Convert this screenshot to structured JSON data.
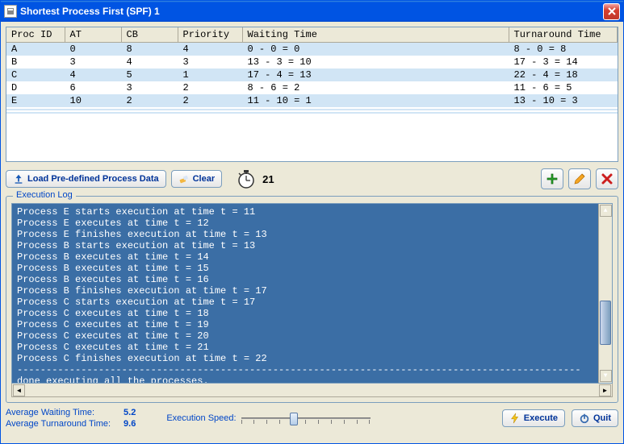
{
  "window": {
    "title": "Shortest Process First (SPF) 1"
  },
  "table": {
    "headers": [
      "Proc ID",
      "AT",
      "CB",
      "Priority",
      "Waiting Time",
      "Turnaround Time"
    ],
    "rows": [
      {
        "pid": "A",
        "at": "0",
        "cb": "8",
        "pr": "4",
        "wt": "0 - 0 = 0",
        "tt": "8 - 0 = 8"
      },
      {
        "pid": "B",
        "at": "3",
        "cb": "4",
        "pr": "3",
        "wt": "13 - 3 = 10",
        "tt": "17 - 3 = 14"
      },
      {
        "pid": "C",
        "at": "4",
        "cb": "5",
        "pr": "1",
        "wt": "17 - 4 = 13",
        "tt": "22 - 4 = 18"
      },
      {
        "pid": "D",
        "at": "6",
        "cb": "3",
        "pr": "2",
        "wt": "8 - 6 = 2",
        "tt": "11 - 6 = 5"
      },
      {
        "pid": "E",
        "at": "10",
        "cb": "2",
        "pr": "2",
        "wt": "11 - 10 = 1",
        "tt": "13 - 10 = 3"
      }
    ]
  },
  "buttons": {
    "load": "Load Pre-defined Process Data",
    "clear": "Clear",
    "execute": "Execute",
    "quit": "Quit"
  },
  "clock": "21",
  "legend": "Execution Log",
  "log_lines": [
    "Process E starts execution at time t = 11",
    "Process E executes at time t = 12",
    "Process E finishes execution at time t = 13",
    "Process B starts execution at time t = 13",
    "Process B executes at time t = 14",
    "Process B executes at time t = 15",
    "Process B executes at time t = 16",
    "Process B finishes execution at time t = 17",
    "Process C starts execution at time t = 17",
    "Process C executes at time t = 18",
    "Process C executes at time t = 19",
    "Process C executes at time t = 20",
    "Process C executes at time t = 21",
    "Process C finishes execution at time t = 22",
    "-------------------------------------------------------------------------------------------------",
    "done executing all the processes."
  ],
  "stats": {
    "avg_wait_label": "Average Waiting Time:",
    "avg_wait_value": "5.2",
    "avg_turn_label": "Average Turnaround Time:",
    "avg_turn_value": "9.6"
  },
  "speed_label": "Execution Speed:",
  "colors": {
    "accent": "#0046c7",
    "log_bg": "#3b6ea5",
    "row_stripe": "#d1e5f5"
  }
}
